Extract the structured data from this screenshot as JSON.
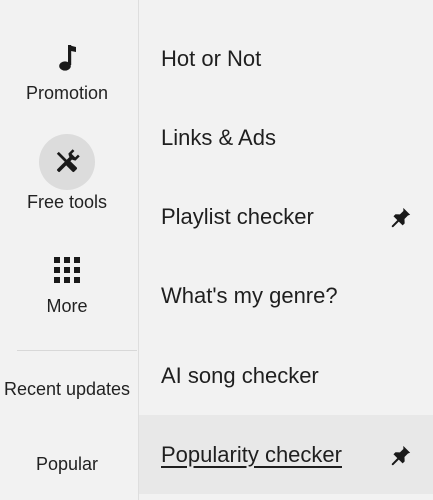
{
  "rail": {
    "items": [
      {
        "label": "Promotion",
        "icon": "music-note-icon",
        "active": false
      },
      {
        "label": "Free tools",
        "icon": "tools-icon",
        "active": true
      },
      {
        "label": "More",
        "icon": "grid-icon",
        "active": false
      }
    ],
    "links": [
      {
        "label": "Recent updates"
      },
      {
        "label": "Popular"
      }
    ]
  },
  "menu": {
    "items": [
      {
        "label": "Hot or Not",
        "pinned": false,
        "highlighted": false,
        "underlined": false
      },
      {
        "label": "Links & Ads",
        "pinned": false,
        "highlighted": false,
        "underlined": false
      },
      {
        "label": "Playlist checker",
        "pinned": true,
        "highlighted": false,
        "underlined": false
      },
      {
        "label": "What's my genre?",
        "pinned": false,
        "highlighted": false,
        "underlined": false
      },
      {
        "label": "AI song checker",
        "pinned": false,
        "highlighted": false,
        "underlined": false
      },
      {
        "label": "Popularity checker",
        "pinned": true,
        "highlighted": true,
        "underlined": true
      }
    ],
    "pin_icon": "pin-icon"
  },
  "colors": {
    "background": "#f2f2f2",
    "active_icon_bg": "#dcdcdc",
    "highlight_row": "#e8e8e8",
    "text": "#1f1f1f"
  }
}
